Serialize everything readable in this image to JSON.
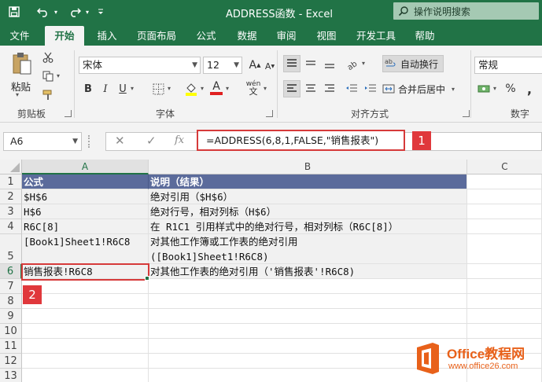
{
  "window": {
    "title": "ADDRESS函数 - Excel",
    "search_placeholder": "操作说明搜索"
  },
  "tabs": [
    "文件",
    "开始",
    "插入",
    "页面布局",
    "公式",
    "数据",
    "审阅",
    "视图",
    "开发工具",
    "帮助"
  ],
  "ribbon": {
    "paste_label": "粘贴",
    "clipboard_label": "剪贴板",
    "font_name": "宋体",
    "font_size": "12",
    "font_label": "字体",
    "bold": "B",
    "italic": "I",
    "underline": "U",
    "font_color_glyph": "A",
    "wen_glyph": "wén",
    "wrap_text": "自动换行",
    "merge_center": "合并后居中",
    "alignment_label": "对齐方式",
    "number_format": "常规",
    "number_label": "数字",
    "percent": "%",
    "comma": ","
  },
  "formula_bar": {
    "name_box": "A6",
    "fx": "fx",
    "formula": "=ADDRESS(6,8,1,FALSE,\"销售报表\")",
    "callout": "1"
  },
  "sheet": {
    "columns": [
      "A",
      "B",
      "C"
    ],
    "rows": [
      "1",
      "2",
      "3",
      "4",
      "5",
      "6",
      "7",
      "8",
      "9",
      "10",
      "11",
      "12",
      "13"
    ],
    "header": {
      "a": "公式",
      "b": "说明（结果）"
    },
    "data": [
      {
        "a": "$H$6",
        "b": "绝对引用（$H$6）"
      },
      {
        "a": "H$6",
        "b": "绝对行号，相对列标（H$6）"
      },
      {
        "a": "R6C[8]",
        "b": "在 R1C1 引用样式中的绝对行号，相对列标（R6C[8]）"
      },
      {
        "a": "[Book1]Sheet1!R6C8",
        "b": "对其他工作簿或工作表的绝对引用",
        "b2": "([Book1]Sheet1!R6C8)"
      },
      {
        "a": "销售报表!R6C8",
        "b": "对其他工作表的绝对引用（'销售报表'!R6C8)"
      }
    ],
    "selected_cell": "A6",
    "callout": "2"
  },
  "watermark": {
    "brand": "Office教程网",
    "url": "www.office26.com"
  },
  "colors": {
    "excel_green": "#217346",
    "header_fill": "#5b6b9b",
    "callout_red": "#e0383c",
    "watermark_orange": "#e8611a"
  }
}
